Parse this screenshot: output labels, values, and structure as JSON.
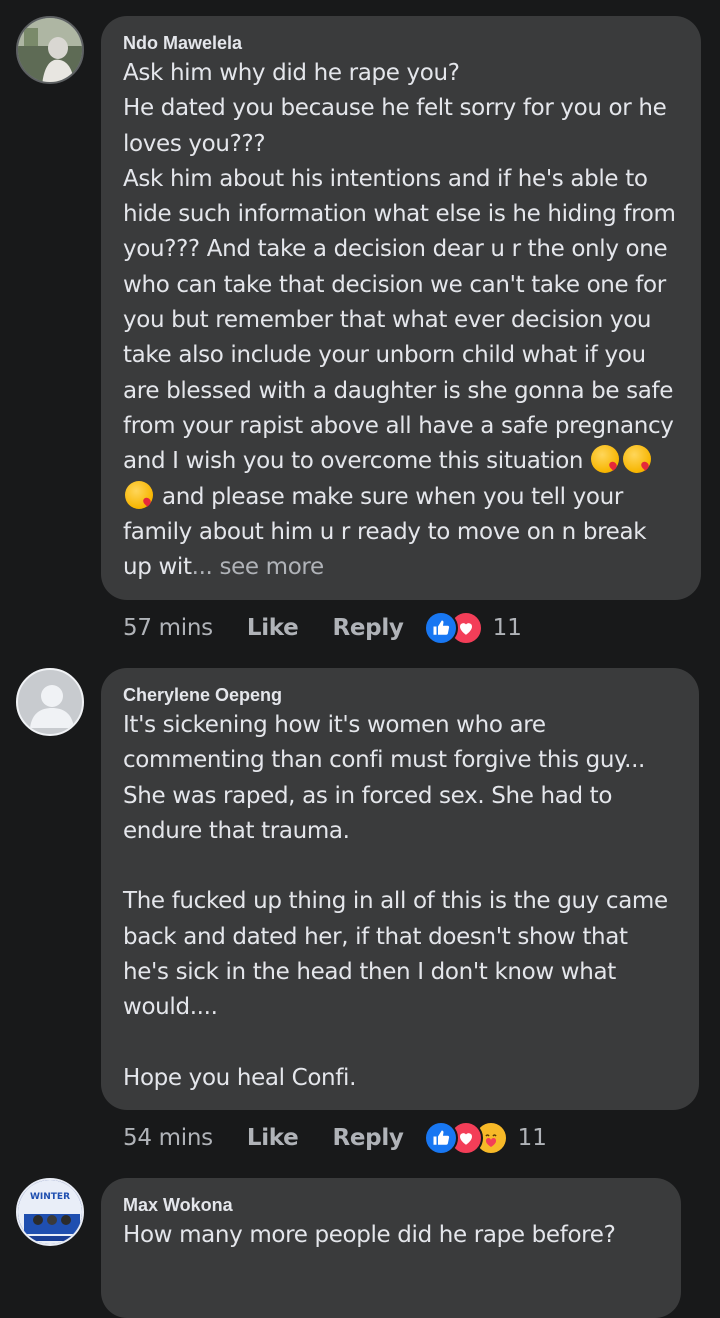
{
  "comments": [
    {
      "author": "Ndo Mawelela",
      "text": "Ask him why did he rape you?\nHe dated you because he felt sorry for you or he loves you???\nAsk him about his intentions and if he's able to hide such information what else is he hiding from you??? And take a decision dear u r the only one who can take that decision we can't take one for you but remember that what ever decision you take also include your unborn child what if you are blessed with a daughter is she gonna be safe from your rapist above all have a safe pregnancy and I wish you to overcome this situation",
      "text_after_emoji": " and please make sure when you tell your family about him u r ready to move on n break up wit",
      "see_more": "... see more",
      "time": "57 mins",
      "like_label": "Like",
      "reply_label": "Reply",
      "reaction_count": "11",
      "reactions": [
        "like-icon",
        "love-icon"
      ]
    },
    {
      "author": "Cherylene Oepeng",
      "text": "It's sickening how it's women who are commenting than confi must forgive this guy... She was raped, as in forced sex. She had to endure that trauma.\n\nThe fucked up thing in all of this is the guy came back and dated her, if that doesn't show that he's sick in the head then I don't know what would....\n\nHope you heal Confi.",
      "time": "54 mins",
      "like_label": "Like",
      "reply_label": "Reply",
      "reaction_count": "11",
      "reactions": [
        "like-icon",
        "love-icon",
        "care-icon"
      ]
    },
    {
      "author": "Max Wokona",
      "text": "How many more people did he rape before?",
      "avatar_text": "WINTER"
    }
  ],
  "colors": {
    "background": "#18191a",
    "bubble": "#3a3b3c",
    "text": "#e4e6eb",
    "muted": "#b0b3b8",
    "like_blue": "#1877f2",
    "love_red": "#f33e58",
    "care_yellow": "#f7b928"
  }
}
